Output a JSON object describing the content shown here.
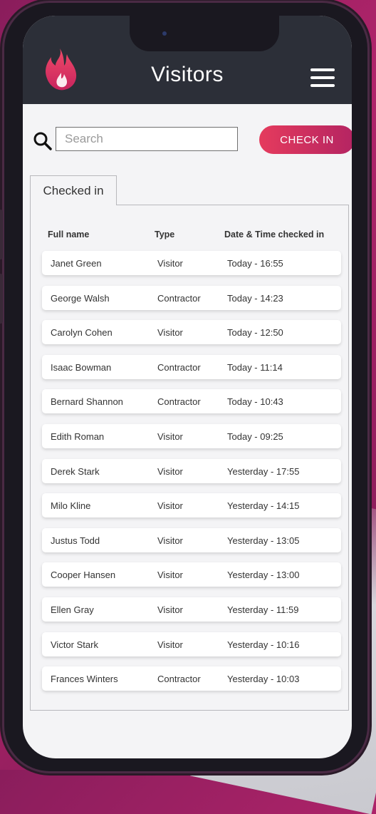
{
  "header": {
    "title": "Visitors"
  },
  "search": {
    "placeholder": "Search"
  },
  "actions": {
    "check_in_label": "CHECK IN"
  },
  "tabs": [
    {
      "label": "Checked in"
    }
  ],
  "table": {
    "columns": [
      "Full name",
      "Type",
      "Date & Time checked in"
    ],
    "rows": [
      {
        "name": "Janet Green",
        "type": "Visitor",
        "time": "Today - 16:55"
      },
      {
        "name": "George Walsh",
        "type": "Contractor",
        "time": "Today - 14:23"
      },
      {
        "name": "Carolyn Cohen",
        "type": "Visitor",
        "time": "Today - 12:50"
      },
      {
        "name": "Isaac Bowman",
        "type": "Contractor",
        "time": "Today - 11:14"
      },
      {
        "name": "Bernard Shannon",
        "type": "Contractor",
        "time": "Today - 10:43"
      },
      {
        "name": "Edith Roman",
        "type": "Visitor",
        "time": "Today - 09:25"
      },
      {
        "name": "Derek Stark",
        "type": "Visitor",
        "time": "Yesterday - 17:55"
      },
      {
        "name": "Milo Kline",
        "type": "Visitor",
        "time": "Yesterday - 14:15"
      },
      {
        "name": "Justus Todd",
        "type": "Visitor",
        "time": "Yesterday - 13:05"
      },
      {
        "name": "Cooper Hansen",
        "type": "Visitor",
        "time": "Yesterday - 13:00"
      },
      {
        "name": "Ellen Gray",
        "type": "Visitor",
        "time": "Yesterday - 11:59"
      },
      {
        "name": "Victor Stark",
        "type": "Visitor",
        "time": "Yesterday - 10:16"
      },
      {
        "name": "Frances Winters",
        "type": "Contractor",
        "time": "Yesterday - 10:03"
      }
    ]
  },
  "icons": {
    "logo": "flame-logo-icon",
    "menu": "hamburger-menu-icon",
    "search": "search-icon"
  },
  "colors": {
    "appbar": "#2c2f38",
    "accent_start": "#e53b5d",
    "accent_end": "#b42462",
    "screen_bg": "#f4f4f6"
  }
}
